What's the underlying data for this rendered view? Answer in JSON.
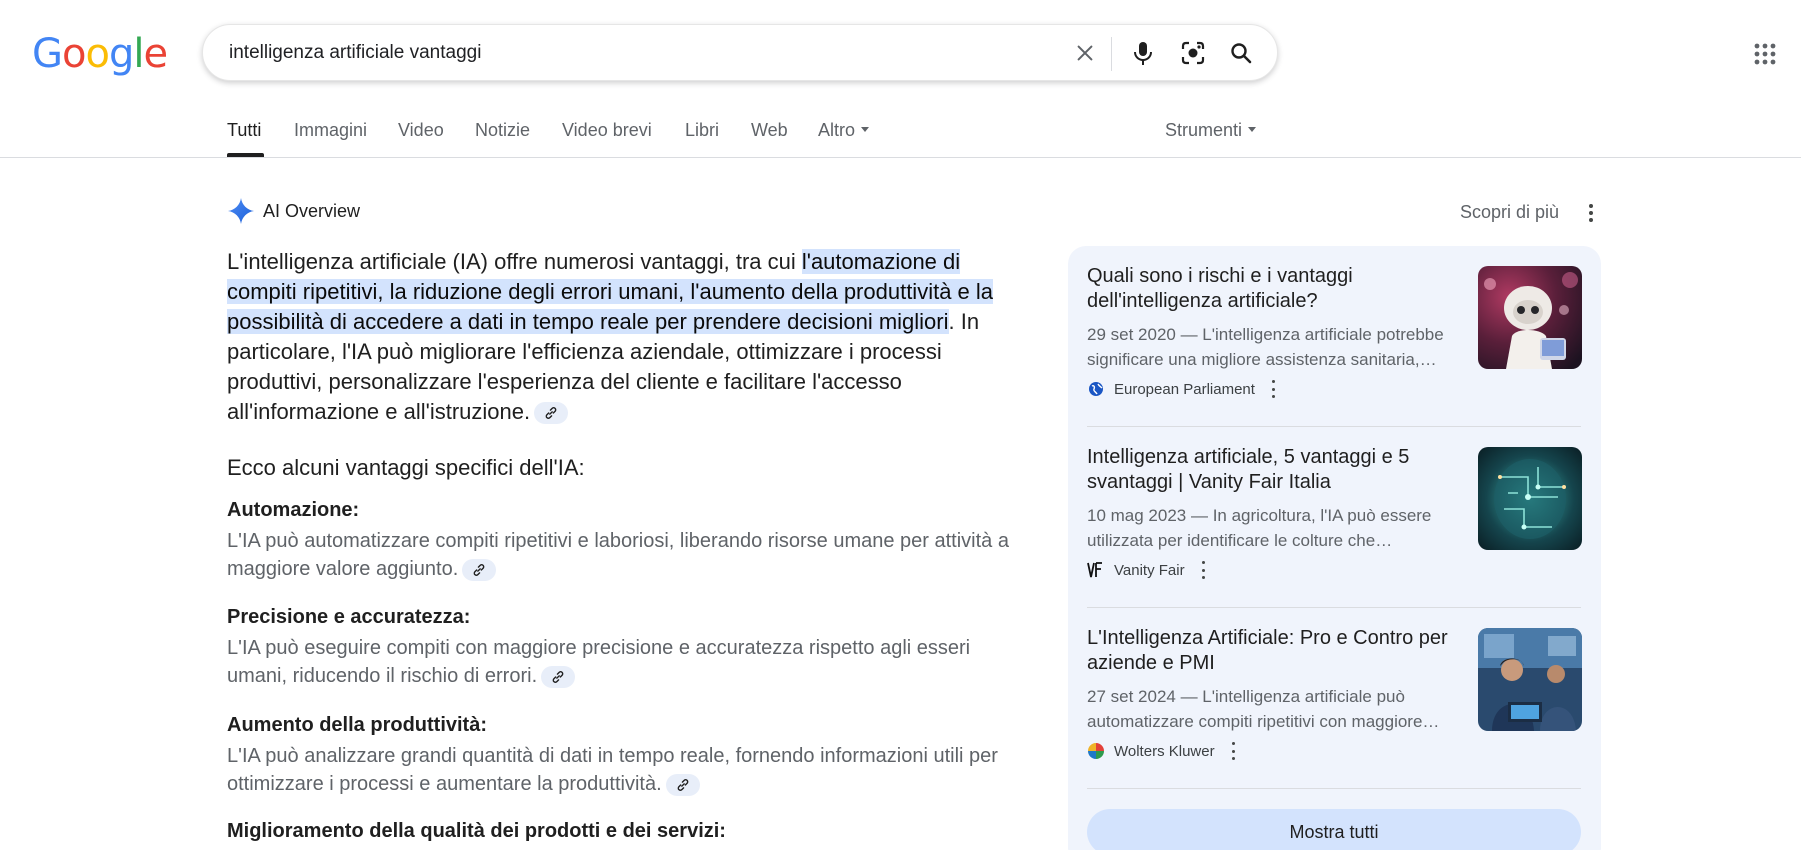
{
  "logo": {
    "letters": [
      "G",
      "o",
      "o",
      "g",
      "l",
      "e"
    ]
  },
  "search": {
    "query": "intelligenza artificiale vantaggi"
  },
  "tabs": [
    {
      "label": "Tutti"
    },
    {
      "label": "Immagini"
    },
    {
      "label": "Video"
    },
    {
      "label": "Notizie"
    },
    {
      "label": "Video brevi"
    },
    {
      "label": "Libri"
    },
    {
      "label": "Web"
    },
    {
      "label": "Altro"
    }
  ],
  "tools_label": "Strumenti",
  "ai": {
    "title": "AI Overview",
    "learn_more": "Scopri di più",
    "intro_pre": "L'intelligenza artificiale (IA) offre numerosi vantaggi, tra cui ",
    "intro_hl": "l'automazione di compiti ripetitivi, la riduzione degli errori umani, l'aumento della produttività e la possibilità di accedere a dati in tempo reale per prendere decisioni migliori",
    "intro_post": ". In particolare, l'IA può migliorare l'efficienza aziendale, ottimizzare i processi produttivi, personalizzare l'esperienza del cliente e facilitare l'accesso all'informazione e all'istruzione.",
    "sub_heading": "Ecco alcuni vantaggi specifici dell'IA:",
    "items": [
      {
        "title": "Automazione:",
        "text": "L'IA può automatizzare compiti ripetitivi e laboriosi, liberando risorse umane per attività a maggiore valore aggiunto."
      },
      {
        "title": "Precisione e accuratezza:",
        "text": "L'IA può eseguire compiti con maggiore precisione e accuratezza rispetto agli esseri umani, riducendo il rischio di errori."
      },
      {
        "title": "Aumento della produttività:",
        "text": "L'IA può analizzare grandi quantità di dati in tempo reale, fornendo informazioni utili per ottimizzare i processi e aumentare la produttività."
      },
      {
        "title": "Miglioramento della qualità dei prodotti e dei servizi:",
        "text": ""
      }
    ]
  },
  "sources": [
    {
      "title": "Quali sono i rischi e i vantaggi dell'intelligenza artificiale?",
      "snippet": "29 set 2020 — L'intelligenza artificiale potrebbe significare una migliore assistenza sanitaria,…",
      "source": "European Parliament"
    },
    {
      "title": "Intelligenza artificiale, 5 vantaggi e 5 svantaggi | Vanity Fair Italia",
      "snippet": "10 mag 2023 — In agricoltura, l'IA può essere utilizzata per identificare le colture che…",
      "source": "Vanity Fair"
    },
    {
      "title": "L'Intelligenza Artificiale: Pro e Contro per aziende e PMI",
      "snippet": "27 set 2024 — L'intelligenza artificiale può automatizzare compiti ripetitivi con maggiore…",
      "source": "Wolters Kluwer"
    }
  ],
  "show_all_label": "Mostra tutti"
}
